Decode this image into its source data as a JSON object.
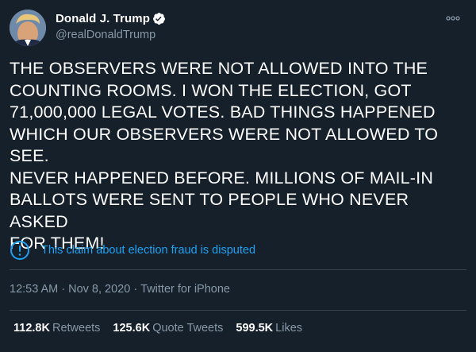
{
  "author": {
    "display_name": "Donald J. Trump",
    "handle": "@realDonaldTrump",
    "verified": true,
    "avatar_icon": "profile-photo"
  },
  "tweet": {
    "text": "THE OBSERVERS WERE NOT ALLOWED INTO THE\nCOUNTING ROOMS. I WON THE ELECTION, GOT\n71,000,000 LEGAL VOTES. BAD THINGS HAPPENED\nWHICH OUR OBSERVERS WERE NOT ALLOWED TO SEE.\nNEVER HAPPENED BEFORE. MILLIONS OF MAIL-IN\nBALLOTS WERE SENT TO PEOPLE WHO NEVER ASKED\nFOR THEM!"
  },
  "notice": {
    "icon": "exclamation-circle-icon",
    "text": "This claim about election fraud is disputed"
  },
  "meta": {
    "time": "12:53 AM",
    "date": "Nov 8, 2020",
    "source": "Twitter for iPhone",
    "separator": "·"
  },
  "stats": {
    "retweets": {
      "count": "112.8K",
      "label": "Retweets"
    },
    "quote_tweets": {
      "count": "125.6K",
      "label": "Quote Tweets"
    },
    "likes": {
      "count": "599.5K",
      "label": "Likes"
    }
  },
  "colors": {
    "background": "#15202b",
    "text": "#ffffff",
    "secondary": "#8899a6",
    "accent": "#1da1f2",
    "divider": "#38444d"
  }
}
